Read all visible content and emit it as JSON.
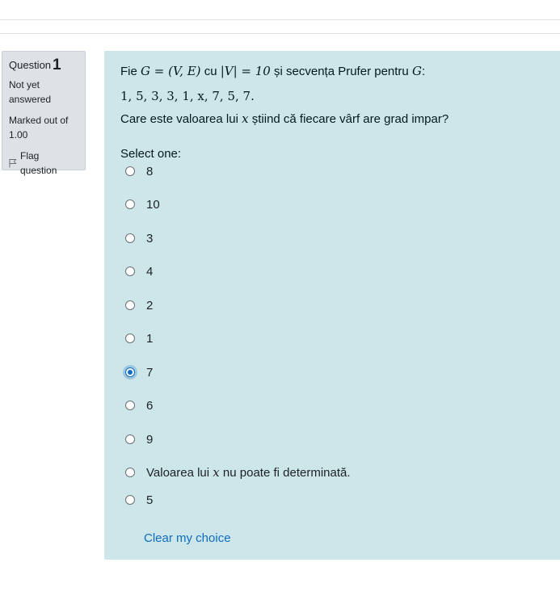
{
  "question": {
    "label": "Question",
    "number": "1",
    "state": "Not yet answered",
    "grade": "Marked out of 1.00",
    "flag_label": "Flag question"
  },
  "qtext": {
    "line1_prefix": "Fie",
    "line1_math_a": "G = (V, E)",
    "line1_mid": "cu",
    "line1_math_b": "|V| = 10",
    "line1_suffix": "și secvența Prufer pentru",
    "line1_math_c": "G",
    "line1_end": ":",
    "sequence": "1, 5, 3, 3, 1, x, 7, 5, 7.",
    "line3_prefix": "Care este valoarea lui",
    "line3_math": "x",
    "line3_suffix": "știind că fiecare vârf are grad impar?"
  },
  "prompt": "Select one:",
  "options": [
    {
      "label": "8",
      "checked": false
    },
    {
      "label": "10",
      "checked": false
    },
    {
      "label": "3",
      "checked": false
    },
    {
      "label": "4",
      "checked": false
    },
    {
      "label": "2",
      "checked": false
    },
    {
      "label": "1",
      "checked": false
    },
    {
      "label": "7",
      "checked": true
    },
    {
      "label": "6",
      "checked": false
    },
    {
      "label": "9",
      "checked": false
    },
    {
      "label_prefix": "Valoarea lui",
      "label_math": "x",
      "label_suffix": "nu poate fi determinată.",
      "checked": false
    },
    {
      "label": "5",
      "checked": false
    }
  ],
  "clear_label": "Clear my choice",
  "colors": {
    "panel_bg": "#cce6ea",
    "info_bg": "#dee2e6",
    "accent": "#0f6cbf"
  }
}
